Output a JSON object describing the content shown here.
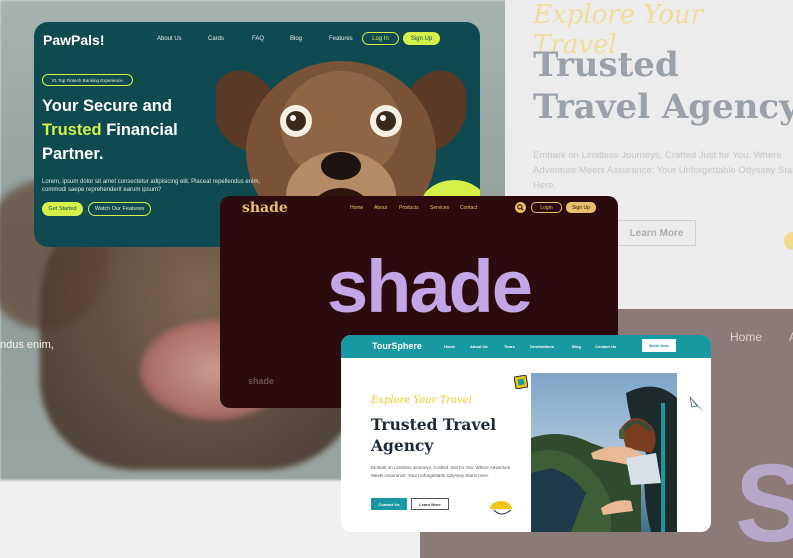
{
  "background": {
    "left_text": "ndus enim,",
    "right_script": "Explore Your Travel",
    "right_title": "Trusted Travel Agency",
    "right_para": "Embark on Limitless Journeys, Crafted Just for You. Where Adventure Meets Assurance: Your Unforgettable Odyssey Starts Here.",
    "right_button": "Learn More",
    "brown_nav_home": "Home",
    "brown_nav_a": "A",
    "brown_text": "Sh"
  },
  "pawpals": {
    "logo": "PawPals!",
    "nav": [
      "About Us",
      "Cards",
      "FAQ",
      "Blog",
      "Features"
    ],
    "login": "Log In",
    "signup": "Sign Up",
    "pill": "#1 Top Fintech Banking Experience",
    "headline_1": "Your Secure and",
    "headline_highlight": "Trusted",
    "headline_2": " Financial Partner.",
    "paragraph": "Lorem, ipsum dolor sit amet consectetur adipisicing elit. Placeat repellendus enim, commodi saepe reprehenderit earum ipsum?",
    "get_started": "Get Started",
    "watch_features": "Watch Our Features",
    "colors": {
      "bg": "#0f4a50",
      "accent": "#d6f04a"
    }
  },
  "shade": {
    "logo": "shade",
    "nav": [
      "Home",
      "About",
      "Products",
      "Services",
      "Contact"
    ],
    "login": "Login",
    "signup": "Sign Up",
    "hero": "shade",
    "small_logo": "shade",
    "colors": {
      "bg": "#2c0b0f",
      "gold": "#e8c06a",
      "lavender": "#c3a6e6"
    }
  },
  "toursphere": {
    "logo": "TourSphere",
    "nav": [
      "Home",
      "About Us",
      "Tours",
      "Destinations",
      "Blog",
      "Contact Us"
    ],
    "book_now": "Book Now",
    "script": "Explore Your Travel",
    "title": "Trusted Travel Agency",
    "paragraph": "Embark on Limitless Journeys, Crafted Just for You. Where Adventure Meets Assurance: Your Unforgettable Odyssey Starts Here.",
    "contact_us": "Contact Us",
    "learn_more": "Learn More",
    "colors": {
      "teal": "#1898a0",
      "yellow": "#f2c419"
    }
  }
}
